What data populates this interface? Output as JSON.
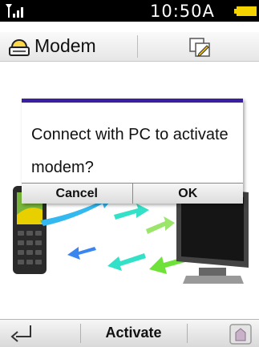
{
  "status_bar": {
    "time": "10:50A",
    "icons": [
      "signal-icon",
      "battery-icon"
    ]
  },
  "title_bar": {
    "title": "Modem",
    "icons": [
      "modem-icon",
      "edit-icon"
    ]
  },
  "dialog": {
    "message": "Connect with PC to activate modem?",
    "buttons": {
      "cancel": "Cancel",
      "ok": "OK"
    }
  },
  "illustration": {
    "icons": [
      "mobile-phone-icon",
      "data-transfer-arrows-icon",
      "computer-monitor-icon"
    ]
  },
  "softkeys": {
    "center": "Activate",
    "icons": [
      "back-icon",
      "home-icon"
    ]
  },
  "colors": {
    "dialog_accent": "#3b1fa1",
    "battery": "#f5d300",
    "arrow_cyan": "#32e1c8",
    "arrow_green": "#6fe23a"
  }
}
